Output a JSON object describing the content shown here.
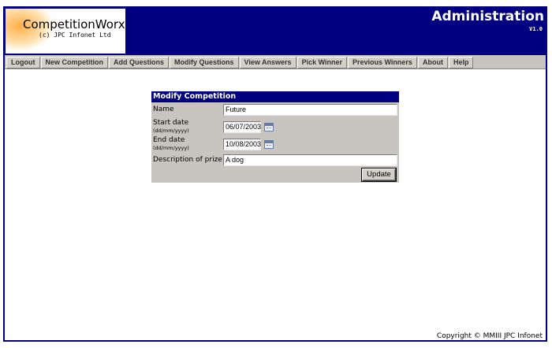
{
  "header": {
    "logo_title": "CompetitionWorx",
    "logo_subtitle": "(c) JPC Infonet Ltd",
    "app_title": "Administration",
    "version": "V1.0",
    "colors": {
      "header_bg": "#000080",
      "panel_bg": "#c8c4c0"
    }
  },
  "nav": {
    "items": [
      {
        "label": "Logout"
      },
      {
        "label": "New Competition"
      },
      {
        "label": "Add Questions"
      },
      {
        "label": "Modify Questions"
      },
      {
        "label": "View Answers"
      },
      {
        "label": "Pick Winner"
      },
      {
        "label": "Previous Winners"
      },
      {
        "label": "About"
      },
      {
        "label": "Help"
      }
    ]
  },
  "form": {
    "title": "Modify Competition",
    "name_label": "Name",
    "name_value": "Future",
    "start_label": "Start date",
    "start_hint": "(dd/mm/yyyy)",
    "start_value": "06/07/2003",
    "end_label": "End date",
    "end_hint": "(dd/mm/yyyy)",
    "end_value": "10/08/2003",
    "prize_label": "Description of prize",
    "prize_value": "A dog",
    "update_label": "Update",
    "calendar_icon": "calendar-icon"
  },
  "footer": {
    "copyright": "Copyright © MMIII JPC Infonet"
  }
}
